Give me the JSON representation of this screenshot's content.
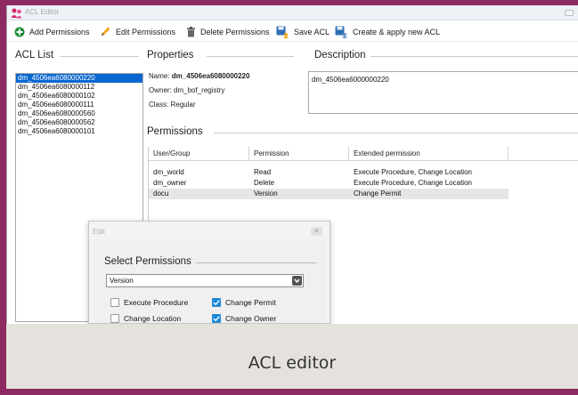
{
  "window": {
    "title": "ACL Editor"
  },
  "toolbar": {
    "add_permissions": "Add Permissions",
    "edit_permissions": "Edit Permissions",
    "delete_permissions": "Delete Permissions",
    "save_acl": "Save ACL",
    "create_apply_acl": "Create & apply new ACL"
  },
  "acl_list": {
    "label": "ACL List",
    "items": [
      "dm_4506ea6080000220",
      "dm_4506ea6080000112",
      "dm_4506ea6080000102",
      "dm_4506ea6080000111",
      "dm_4506ea6080000560",
      "dm_4506ea6080000562",
      "dm_4506ea6080000101"
    ],
    "selected_index": 0
  },
  "properties": {
    "label": "Properties",
    "name_label": "Name:",
    "name_value": "dm_4506ea6080000220",
    "owner_label": "Owner:",
    "owner_value": "dm_bof_registry",
    "class_label": "Class:",
    "class_value": "Regular"
  },
  "description": {
    "label": "Description",
    "value": "dm_4506ea6000000220"
  },
  "permissions": {
    "label": "Permissions",
    "columns": [
      "User/Group",
      "Permission",
      "Extended permission"
    ],
    "rows": [
      {
        "user": "dm_world",
        "permission": "Read",
        "extended": "Execute Procedure, Change Location"
      },
      {
        "user": "dm_owner",
        "permission": "Delete",
        "extended": "Execute Procedure, Change Location"
      },
      {
        "user": "docu",
        "permission": "Version",
        "extended": "Change Permit"
      }
    ]
  },
  "edit_dialog": {
    "title": "Edit",
    "close": "×",
    "section_label": "Select Permissions",
    "selected_permission": "Version",
    "checkboxes": [
      {
        "label": "Execute Procedure",
        "checked": false
      },
      {
        "label": "Change Permit",
        "checked": true
      },
      {
        "label": "Change Location",
        "checked": false
      },
      {
        "label": "Change Owner",
        "checked": true
      }
    ]
  },
  "caption": "ACL editor",
  "colors": {
    "background": "#8e2a62",
    "selection": "#0a67d0",
    "checkbox_checked": "#1f8ad6",
    "caption_panel": "#e5e2dd"
  }
}
